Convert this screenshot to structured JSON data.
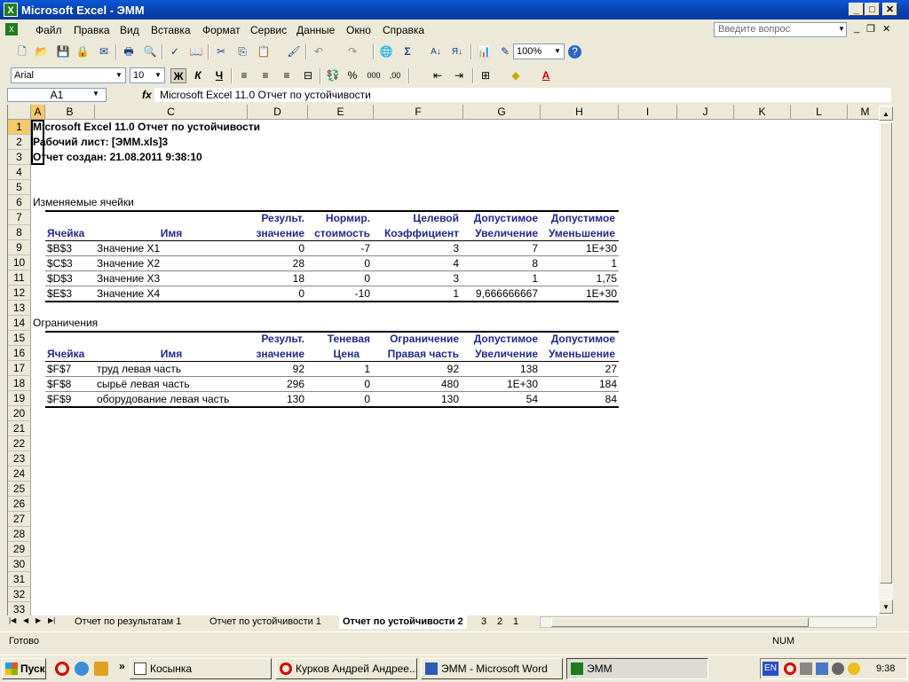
{
  "window": {
    "title": "Microsoft Excel - ЭММ",
    "app_icon": "X"
  },
  "menu": [
    "Файл",
    "Правка",
    "Вид",
    "Вставка",
    "Формат",
    "Сервис",
    "Данные",
    "Окно",
    "Справка"
  ],
  "help_box_placeholder": "Введите вопрос",
  "toolbar": {
    "zoom": "100%",
    "font": "Arial",
    "font_size": "10",
    "bold": "Ж",
    "italic": "К",
    "underline": "Ч",
    "percent": "%",
    "thousands": "000"
  },
  "formula_bar": {
    "name_box": "A1",
    "fx": "fx",
    "content": "Microsoft Excel 11.0 Отчет по устойчивости"
  },
  "columns": [
    "A",
    "B",
    "C",
    "D",
    "E",
    "F",
    "G",
    "H",
    "I",
    "J",
    "K",
    "L",
    "M"
  ],
  "rows": [
    "1",
    "2",
    "3",
    "4",
    "5",
    "6",
    "7",
    "8",
    "9",
    "10",
    "11",
    "12",
    "13",
    "14",
    "15",
    "16",
    "17",
    "18",
    "19",
    "20",
    "21",
    "22",
    "23",
    "24",
    "25",
    "26",
    "27",
    "28",
    "29",
    "30",
    "31",
    "32",
    "33"
  ],
  "report": {
    "line1": "Microsoft Excel 11.0 Отчет по устойчивости",
    "line2": "Рабочий лист: [ЭММ.xls]3",
    "line3": "Отчет создан: 21.08.2011 9:38:10"
  },
  "section1": {
    "title": "Изменяемые ячейки",
    "headers_top": [
      "",
      "",
      "Результ.",
      "Нормир.",
      "Целевой",
      "Допустимое",
      "Допустимое"
    ],
    "headers_bottom": [
      "Ячейка",
      "Имя",
      "значение",
      "стоимость",
      "Коэффициент",
      "Увеличение",
      "Уменьшение"
    ],
    "rows": [
      [
        "$B$3",
        "Значение X1",
        "0",
        "-7",
        "3",
        "7",
        "1E+30"
      ],
      [
        "$C$3",
        "Значение X2",
        "28",
        "0",
        "4",
        "8",
        "1"
      ],
      [
        "$D$3",
        "Значение X3",
        "18",
        "0",
        "3",
        "1",
        "1,75"
      ],
      [
        "$E$3",
        "Значение X4",
        "0",
        "-10",
        "1",
        "9,666666667",
        "1E+30"
      ]
    ]
  },
  "section2": {
    "title": "Ограничения",
    "headers_top": [
      "",
      "",
      "Результ.",
      "Теневая",
      "Ограничение",
      "Допустимое",
      "Допустимое"
    ],
    "headers_bottom": [
      "Ячейка",
      "Имя",
      "значение",
      "Цена",
      "Правая часть",
      "Увеличение",
      "Уменьшение"
    ],
    "rows": [
      [
        "$F$7",
        "труд левая часть",
        "92",
        "1",
        "92",
        "138",
        "27"
      ],
      [
        "$F$8",
        "сырьё левая часть",
        "296",
        "0",
        "480",
        "1E+30",
        "184"
      ],
      [
        "$F$9",
        "оборудование левая часть",
        "130",
        "0",
        "130",
        "54",
        "84"
      ]
    ]
  },
  "tabs": [
    "Отчет по результатам 1",
    "Отчет по устойчивости 1",
    "Отчет по устойчивости 2",
    "3",
    "2",
    "1"
  ],
  "status": {
    "ready": "Готово",
    "num": "NUM"
  },
  "taskbar": {
    "start": "Пуск",
    "tasks": [
      "Косынка",
      "Курков Андрей Андрее...",
      "ЭММ - Microsoft Word",
      "ЭММ"
    ],
    "lang": "EN",
    "clock": "9:38"
  }
}
